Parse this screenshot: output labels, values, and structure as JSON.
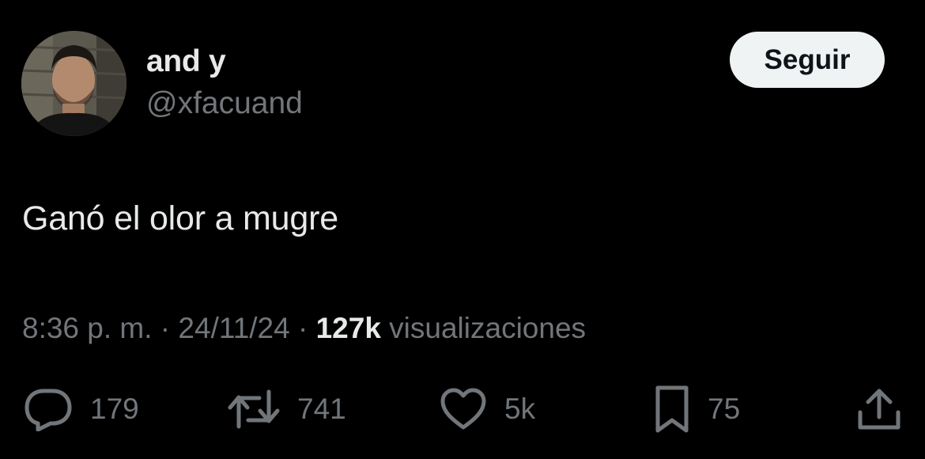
{
  "author": {
    "display_name": "and y",
    "handle": "@xfacuand"
  },
  "follow_button": {
    "label": "Seguir"
  },
  "tweet": {
    "text": "Ganó el olor a mugre"
  },
  "meta": {
    "time": "8:36 p. m.",
    "separator": " · ",
    "date": "24/11/24",
    "views_count": "127k",
    "views_label": " visualizaciones"
  },
  "actions": {
    "replies": "179",
    "reposts": "741",
    "likes": "5k",
    "bookmarks": "75"
  },
  "icons": {
    "reply": "reply-icon",
    "repost": "repost-icon",
    "like": "heart-icon",
    "bookmark": "bookmark-icon",
    "share": "share-icon"
  },
  "colors": {
    "background": "#000000",
    "primary_text": "#e7e9ea",
    "secondary_text": "#71767b",
    "follow_bg": "#eff3f4",
    "follow_text": "#0f1419"
  }
}
